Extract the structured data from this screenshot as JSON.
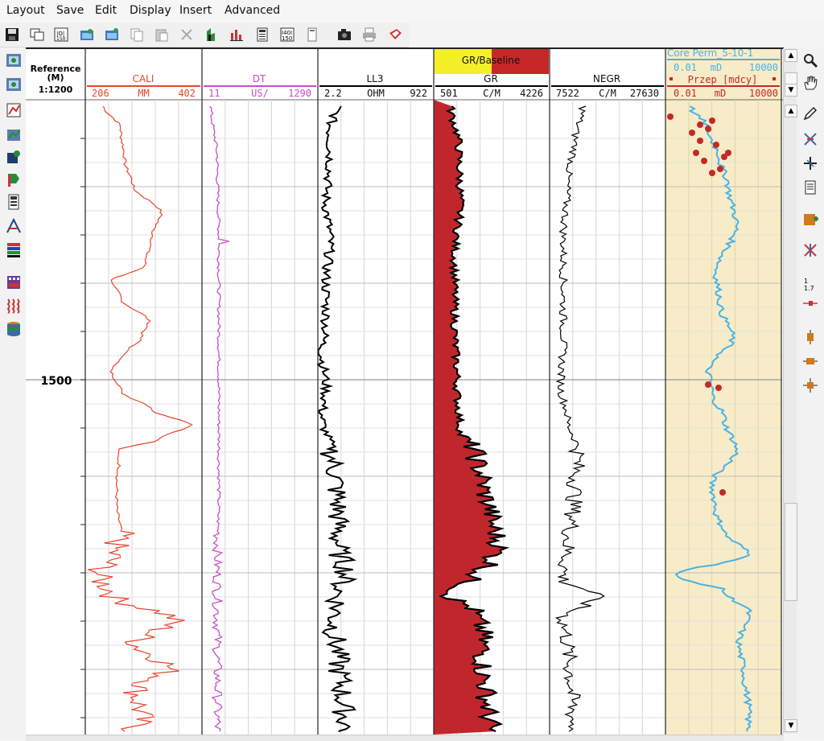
{
  "menu": [
    "Layout",
    "Save",
    "Edit",
    "Display",
    "Insert",
    "Advanced"
  ],
  "toolbar_icons": [
    "save-icon",
    "copy-window-icon",
    "log-150-icon",
    "open-folder-icon",
    "save-folder-icon",
    "copy-icon",
    "paste-icon",
    "delete-icon",
    "well-plot-icon",
    "bar-chart-icon",
    "calculator-icon",
    "log-150-icon",
    "column-icon",
    "camera-icon",
    "print-icon",
    "export-icon"
  ],
  "left_tools": [
    "well-icon",
    "well-add-icon",
    "track-chart-icon",
    "track-chart-add-icon",
    "settings-track-icon",
    "marker-icon",
    "calculator-icon",
    "crossplot-icon",
    "color-stripes-icon",
    "lithology-icon",
    "wave-icon",
    "database-icon"
  ],
  "right_tools": [
    "zoom-icon",
    "pan-hand-icon",
    "pencil-icon",
    "cross-red-icon",
    "cross-black-icon",
    "document-icon",
    "add-track-icon",
    "split-icon",
    "scale-icon",
    "marker-line-icon",
    "box-plot-icon",
    "move-horizontal-icon",
    "move-all-icon"
  ],
  "reference": {
    "title": "Reference",
    "unit": "(M)",
    "scale": "1:1200",
    "depth_label": "1500"
  },
  "tracks": [
    {
      "name": "CALI",
      "color": "#e8452c",
      "min": "206",
      "unit": "MM",
      "max": "402"
    },
    {
      "name": "DT",
      "color": "#c84dc8",
      "min": "11",
      "unit": "US/",
      "max": "1290"
    },
    {
      "name": "LL3",
      "color": "#000000",
      "min": "2.2",
      "unit": "OHM",
      "max": "922"
    },
    {
      "name": "GR",
      "color": "#000000",
      "min": "501",
      "unit": "C/M",
      "max": "4226",
      "banner": "GR/Baseline"
    },
    {
      "name": "NEGR",
      "color": "#000000",
      "min": "7522",
      "unit": "C/M",
      "max": "27630"
    },
    {
      "name": "Core Perm_5-10-1",
      "color": "#4ab2e8",
      "min": "0.01",
      "unit": "mD",
      "max": "10000",
      "name2": "Przep [mdcy]",
      "color2": "#c62828",
      "min2": "0.01",
      "unit2": "mD",
      "max2": "10000"
    }
  ]
}
